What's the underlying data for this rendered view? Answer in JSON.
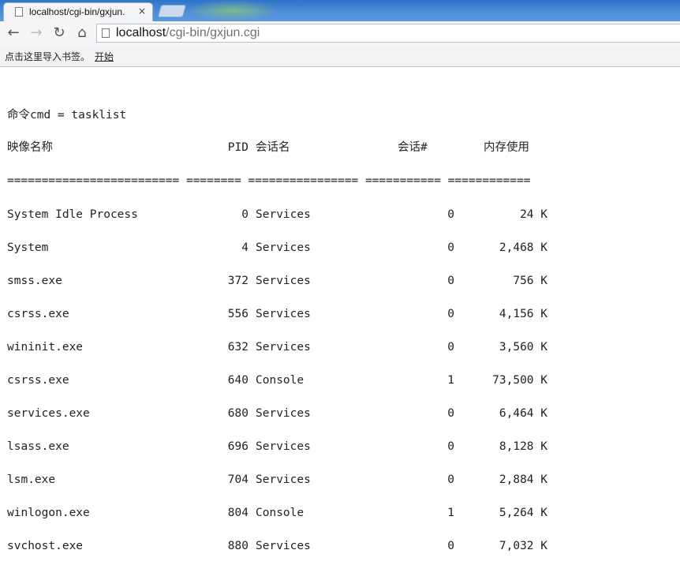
{
  "browser": {
    "tab_title": "localhost/cgi-bin/gxjun.",
    "tab_close": "×",
    "url_host": "localhost",
    "url_path": "/cgi-bin/gxjun.cgi",
    "bookmarks_hint": "点击这里导入书签。",
    "bookmarks_link": "开始"
  },
  "content": {
    "command_line": "命令cmd = tasklist",
    "header": {
      "image_name": "映像名称",
      "pid": "PID",
      "session_name": "会话名",
      "session_num": "会话#",
      "mem_usage": "内存使用"
    },
    "separator": "========================= ======== ================ =========== ============",
    "rows": [
      {
        "name": "System Idle Process",
        "pid": "0",
        "session": "Services",
        "num": "0",
        "mem": "24 K"
      },
      {
        "name": "System",
        "pid": "4",
        "session": "Services",
        "num": "0",
        "mem": "2,468 K"
      },
      {
        "name": "smss.exe",
        "pid": "372",
        "session": "Services",
        "num": "0",
        "mem": "756 K"
      },
      {
        "name": "csrss.exe",
        "pid": "556",
        "session": "Services",
        "num": "0",
        "mem": "4,156 K"
      },
      {
        "name": "wininit.exe",
        "pid": "632",
        "session": "Services",
        "num": "0",
        "mem": "3,560 K"
      },
      {
        "name": "csrss.exe",
        "pid": "640",
        "session": "Console",
        "num": "1",
        "mem": "73,500 K"
      },
      {
        "name": "services.exe",
        "pid": "680",
        "session": "Services",
        "num": "0",
        "mem": "6,464 K"
      },
      {
        "name": "lsass.exe",
        "pid": "696",
        "session": "Services",
        "num": "0",
        "mem": "8,128 K"
      },
      {
        "name": "lsm.exe",
        "pid": "704",
        "session": "Services",
        "num": "0",
        "mem": "2,884 K"
      },
      {
        "name": "winlogon.exe",
        "pid": "804",
        "session": "Console",
        "num": "1",
        "mem": "5,264 K"
      },
      {
        "name": "svchost.exe",
        "pid": "880",
        "session": "Services",
        "num": "0",
        "mem": "7,032 K"
      }
    ]
  }
}
